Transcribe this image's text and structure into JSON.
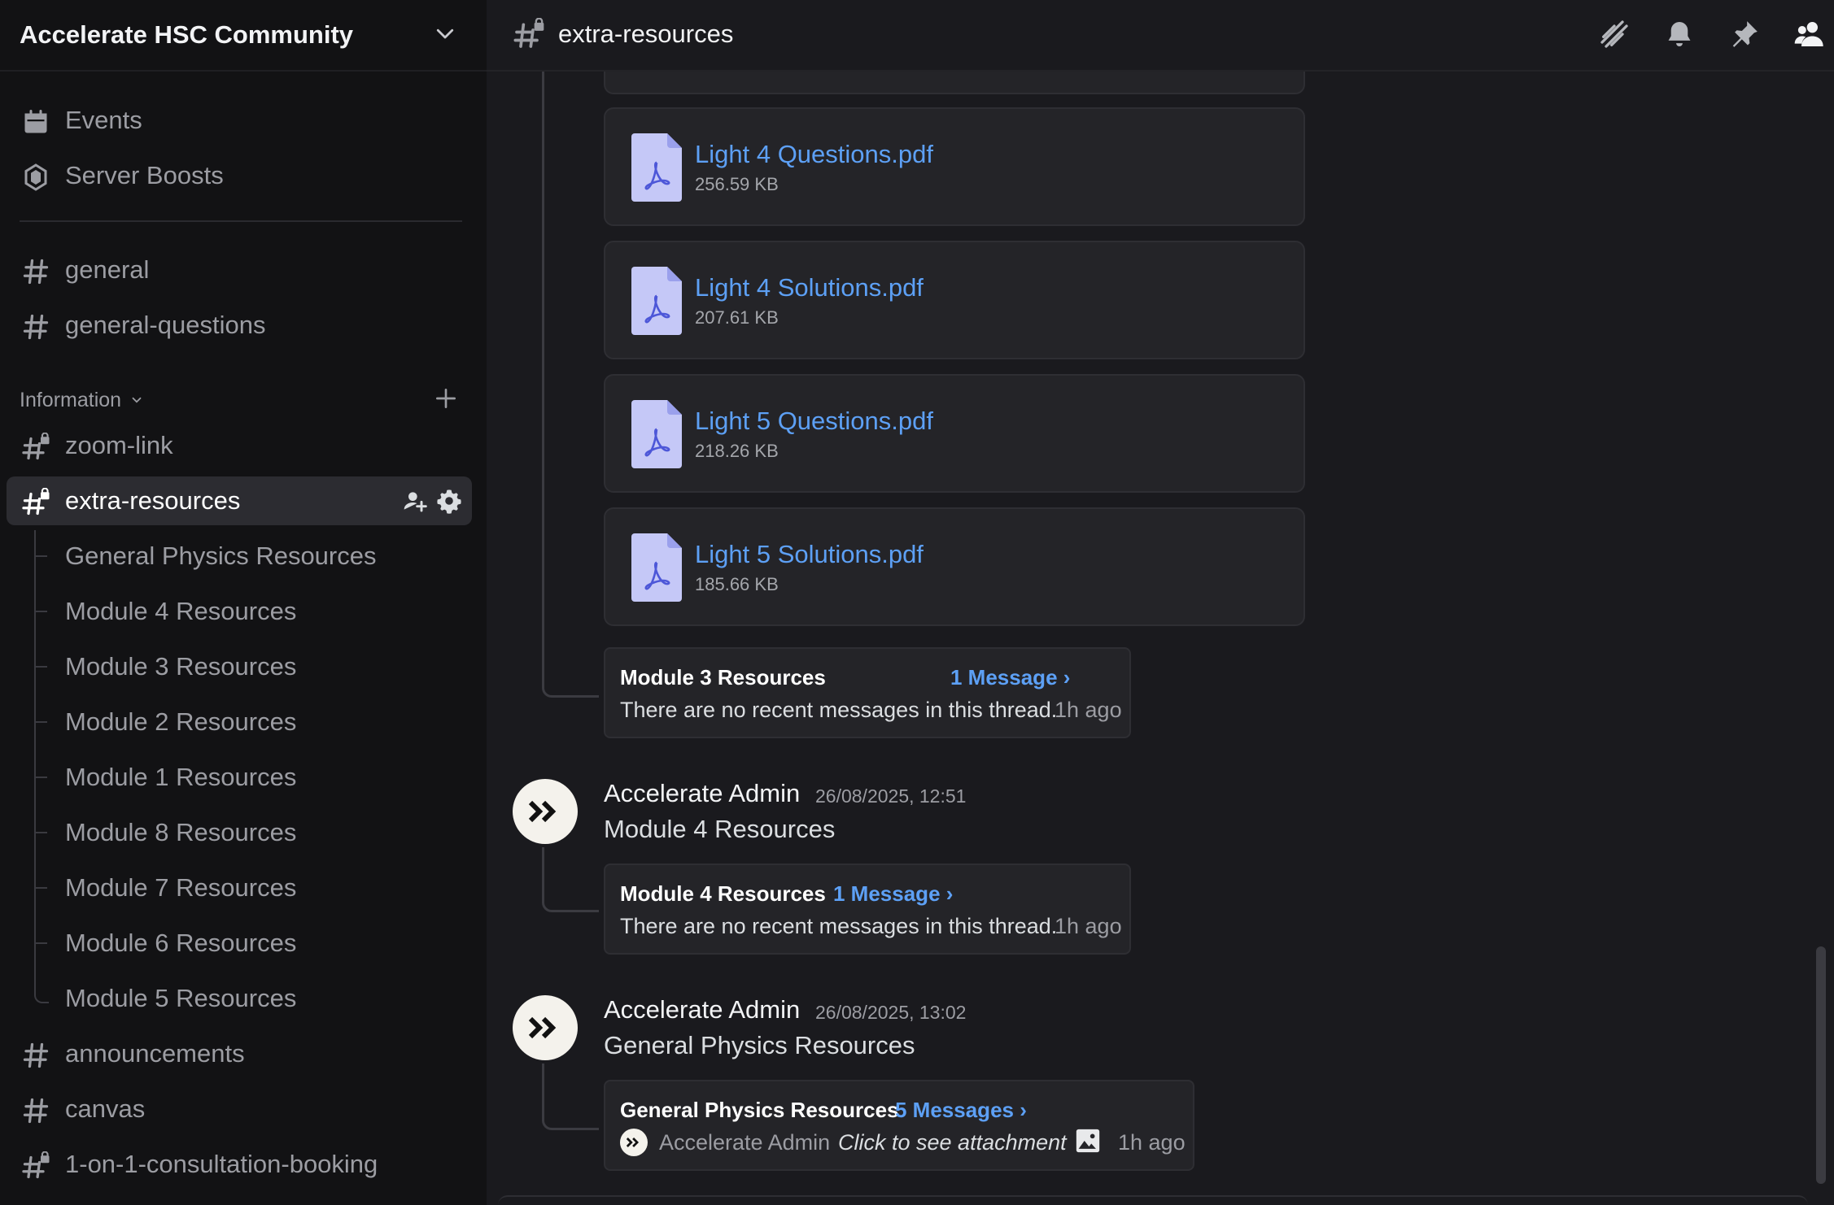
{
  "server": {
    "name": "Accelerate HSC Community"
  },
  "sidebar": {
    "top_items": [
      {
        "label": "Events",
        "icon": "calendar-icon"
      },
      {
        "label": "Server Boosts",
        "icon": "boost-gem-icon"
      }
    ],
    "channels": [
      {
        "label": "general",
        "icon": "hashtag-icon"
      },
      {
        "label": "general-questions",
        "icon": "hashtag-icon"
      }
    ],
    "category": {
      "label": "Information"
    },
    "info_channels": [
      {
        "label": "zoom-link",
        "icon": "locked-hashtag-icon"
      },
      {
        "label": "extra-resources",
        "icon": "locked-hashtag-icon",
        "active": true
      }
    ],
    "threads": [
      "General Physics Resources",
      "Module 4 Resources",
      "Module 3 Resources",
      "Module 2 Resources",
      "Module 1 Resources",
      "Module 8 Resources",
      "Module 7 Resources",
      "Module 6 Resources",
      "Module 5 Resources"
    ],
    "more_channels": [
      {
        "label": "announcements",
        "icon": "hashtag-icon"
      },
      {
        "label": "canvas",
        "icon": "hashtag-icon"
      },
      {
        "label": "1-on-1-consultation-booking",
        "icon": "locked-hashtag-icon"
      }
    ]
  },
  "header": {
    "channel": "extra-resources"
  },
  "files": [
    {
      "name": "Light 4 Questions.pdf",
      "size": "256.59 KB"
    },
    {
      "name": "Light 4 Solutions.pdf",
      "size": "207.61 KB"
    },
    {
      "name": "Light 5 Questions.pdf",
      "size": "218.26 KB"
    },
    {
      "name": "Light 5 Solutions.pdf",
      "size": "185.66 KB"
    }
  ],
  "thread_m3": {
    "name": "Module 3 Resources",
    "count": "1 Message ›",
    "text": "There are no recent messages in this thread.",
    "ago": "1h ago"
  },
  "messages": [
    {
      "author": "Accelerate Admin",
      "timestamp": "26/08/2025, 12:51",
      "content": "Module 4 Resources",
      "thread": {
        "name": "Module 4 Resources",
        "count": "1 Message ›",
        "text": "There are no recent messages in this thread.",
        "ago": "1h ago"
      }
    },
    {
      "author": "Accelerate Admin",
      "timestamp": "26/08/2025, 13:02",
      "content": "General Physics Resources",
      "thread": {
        "name": "General Physics Resources",
        "count": "5 Messages ›",
        "last_author": "Accelerate Admin",
        "attachment": "Click to see attachment",
        "ago": "1h ago"
      }
    }
  ],
  "colors": {
    "link": "#5da0f5",
    "sidebar_bg": "#121214",
    "main_bg": "#1a1a1e",
    "active_row": "#2c2c31"
  }
}
